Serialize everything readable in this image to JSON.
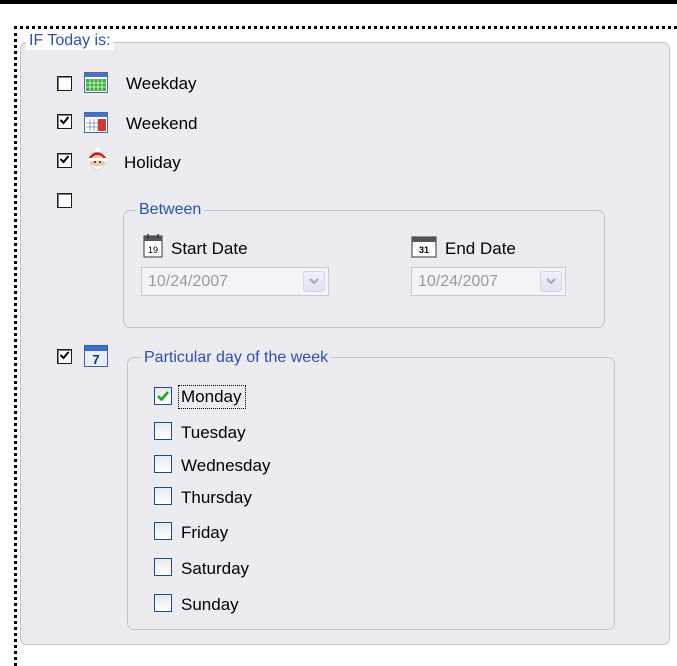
{
  "main_group": {
    "legend": "IF Today is:",
    "options": [
      {
        "label": "Weekday",
        "checked": false,
        "icon": "calendar-week-icon"
      },
      {
        "label": "Weekend",
        "checked": true,
        "icon": "calendar-weekend-icon"
      },
      {
        "label": "Holiday",
        "checked": true,
        "icon": "santa-holiday-icon"
      }
    ],
    "between_checked": false,
    "particular_checked": true
  },
  "between": {
    "legend": "Between",
    "start_label": "Start Date",
    "start_value": "10/24/2007",
    "start_icon_text": "19",
    "end_label": "End Date",
    "end_value": "10/24/2007",
    "end_icon_text": "31"
  },
  "particular": {
    "legend": "Particular day of the week",
    "icon_text": "7",
    "days": [
      {
        "label": "Monday",
        "checked": true
      },
      {
        "label": "Tuesday",
        "checked": false
      },
      {
        "label": "Wednesday",
        "checked": false
      },
      {
        "label": "Thursday",
        "checked": false
      },
      {
        "label": "Friday",
        "checked": false
      },
      {
        "label": "Saturday",
        "checked": false
      },
      {
        "label": "Sunday",
        "checked": false
      }
    ]
  },
  "colors": {
    "legend_text": "#2d4fb3",
    "panel_bg": "#ecebf0",
    "accent_check": "#21a121"
  }
}
